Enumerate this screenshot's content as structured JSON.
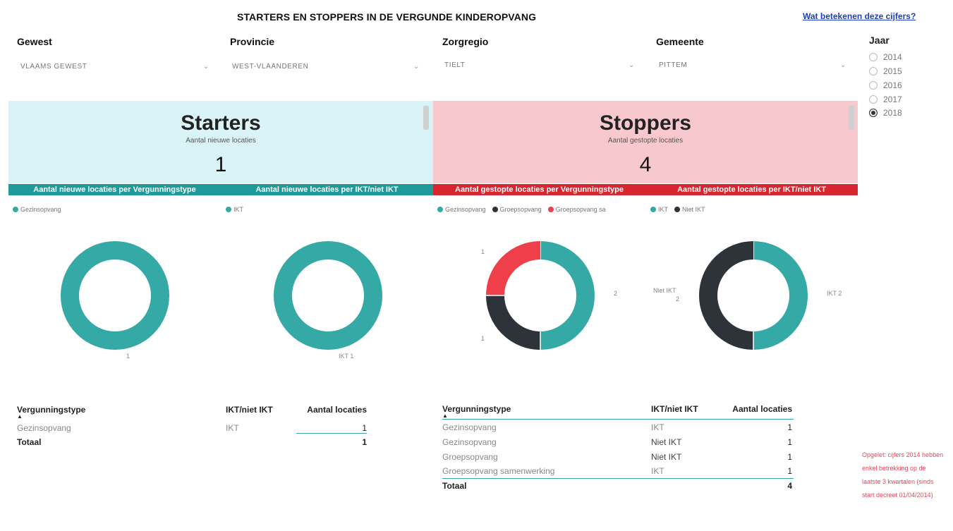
{
  "header": {
    "title": "STARTERS EN STOPPERS IN DE VERGUNDE KINDEROPVANG",
    "help_link": "Wat betekenen deze cijfers?"
  },
  "filters": {
    "gewest": {
      "label": "Gewest",
      "value": "VLAAMS GEWEST"
    },
    "provincie": {
      "label": "Provincie",
      "value": "WEST-VLAANDEREN"
    },
    "zorgregio": {
      "label": "Zorgregio",
      "value": "TIELT"
    },
    "gemeente": {
      "label": "Gemeente",
      "value": "PITTEM"
    }
  },
  "year_filter": {
    "label": "Jaar",
    "options": [
      "2014",
      "2015",
      "2016",
      "2017",
      "2018"
    ],
    "selected": "2018"
  },
  "starters": {
    "heading": "Starters",
    "subtitle": "Aantal nieuwe locaties",
    "value": "1",
    "bar1": "Aantal nieuwe locaties per Vergunningstype",
    "bar2": "Aantal nieuwe locaties per IKT/niet IKT",
    "chart1": {
      "legend": [
        "Gezinsopvang"
      ],
      "labels": [
        "1"
      ]
    },
    "chart2": {
      "legend": [
        "IKT"
      ],
      "labels": [
        "IKT 1"
      ]
    }
  },
  "stoppers": {
    "heading": "Stoppers",
    "subtitle": "Aantal gestopte locaties",
    "value": "4",
    "bar1": "Aantal gestopte locaties per Vergunningstype",
    "bar2": "Aantal gestopte locaties per IKT/niet IKT",
    "chart1": {
      "legend": [
        "Gezinsopvang",
        "Groepsopvang",
        "Groepsopvang sa"
      ],
      "labels": [
        "1",
        "2",
        "1"
      ]
    },
    "chart2": {
      "legend": [
        "IKT",
        "Niet IKT"
      ],
      "label_left_1": "Niet IKT",
      "label_left_2": "2",
      "label_right": "IKT 2"
    }
  },
  "colors": {
    "teal": "#35a9a6",
    "dark": "#2e3239",
    "red": "#ee3f4a",
    "starters_bg": "#d9f3f7",
    "stoppers_bg": "#f7c9cf",
    "starters_bar": "#1f9a9a",
    "stoppers_bar": "#d7262f"
  },
  "chart_data": [
    {
      "type": "pie",
      "categories": [
        "Gezinsopvang"
      ],
      "values": [
        1
      ]
    },
    {
      "type": "pie",
      "categories": [
        "IKT"
      ],
      "values": [
        1
      ]
    },
    {
      "type": "pie",
      "categories": [
        "Gezinsopvang",
        "Groepsopvang",
        "Groepsopvang sa"
      ],
      "values": [
        2,
        1,
        1
      ]
    },
    {
      "type": "pie",
      "categories": [
        "IKT",
        "Niet IKT"
      ],
      "values": [
        2,
        2
      ]
    }
  ],
  "table_starters": {
    "headers": [
      "Vergunningstype",
      "IKT/niet IKT",
      "Aantal locaties"
    ],
    "rows": [
      [
        "Gezinsopvang",
        "IKT",
        "1"
      ]
    ],
    "total_label": "Totaal",
    "total_value": "1"
  },
  "table_stoppers": {
    "headers": [
      "Vergunningstype",
      "IKT/niet IKT",
      "Aantal locaties"
    ],
    "rows": [
      [
        "Gezinsopvang",
        "IKT",
        "1"
      ],
      [
        "Gezinsopvang",
        "Niet IKT",
        "1"
      ],
      [
        "Groepsopvang",
        "Niet IKT",
        "1"
      ],
      [
        "Groepsopvang samenwerking",
        "IKT",
        "1"
      ]
    ],
    "total_label": "Totaal",
    "total_value": "4"
  },
  "footnote": "Opgelet: cijfers 2014 hebben enkel betrekking op de laatste 3 kwartalen (sinds start decreet 01/04/2014)"
}
